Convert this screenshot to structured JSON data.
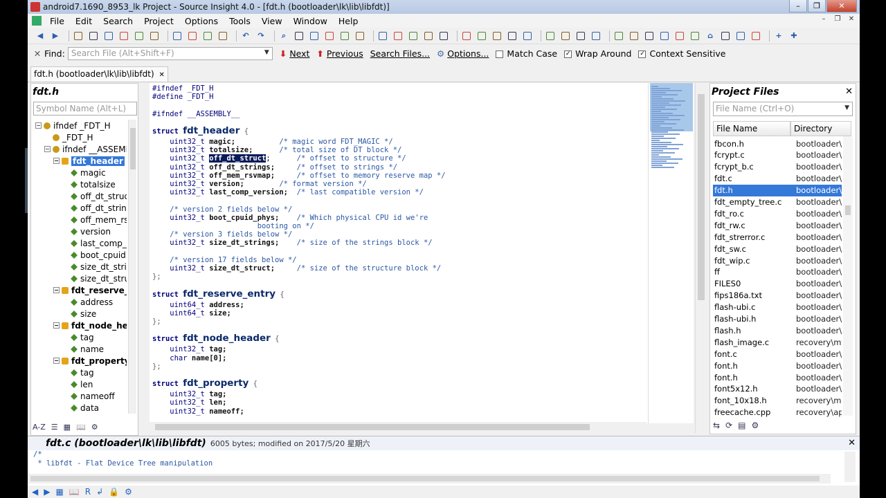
{
  "window": {
    "title": "android7.1690_8953_lk Project - Source Insight 4.0 - [fdt.h (bootloader\\lk\\lib\\libfdt)]",
    "buttons": {
      "min": "–",
      "max": "❐",
      "close": "✕"
    }
  },
  "menu": {
    "items": [
      "File",
      "Edit",
      "Search",
      "Project",
      "Options",
      "Tools",
      "View",
      "Window",
      "Help"
    ],
    "mdi": {
      "min": "–",
      "restore": "❐",
      "close": "✕"
    }
  },
  "toolbar": {
    "icons": [
      "back-arrow-icon",
      "forward-arrow-icon",
      "sep",
      "new-file-icon",
      "open-folder-icon",
      "save-icon",
      "save-all-icon",
      "close-file-icon",
      "print-icon",
      "sep",
      "cut-icon",
      "copy-icon",
      "paste-icon",
      "delete-icon",
      "sep",
      "undo-icon",
      "redo-icon",
      "sep",
      "search-icon",
      "search-files-icon",
      "next-icon",
      "prev-icon",
      "replace-icon",
      "window-icon",
      "sep",
      "bookmark-icon",
      "bookmark-next-icon",
      "bookmark-prev-icon",
      "goto-line-icon",
      "up-icon",
      "sep",
      "browse-icon",
      "symbol-icon",
      "book-icon",
      "jump-icon",
      "reference-icon",
      "sep",
      "layout-icon",
      "panel-left-icon",
      "panel-right-icon",
      "panel-bottom-icon",
      "sep",
      "context-icon",
      "relation-icon",
      "tree-icon",
      "file-icon",
      "settings-icon",
      "print2-icon",
      "home-icon",
      "bird-icon",
      "graph-icon",
      "grid-icon",
      "sep",
      "plus-icon",
      "add-icon"
    ],
    "glyphs": {
      "back-arrow-icon": "◀",
      "forward-arrow-icon": "▶",
      "undo-icon": "↶",
      "redo-icon": "↷",
      "plus-icon": "+",
      "add-icon": "✚",
      "home-icon": "⌂",
      "search-icon": "⌕"
    }
  },
  "findbar": {
    "close": "✕",
    "label": "Find:",
    "placeholder": "Search File (Alt+Shift+F)",
    "dropdown": "▼",
    "next": "Next",
    "previous": "Previous",
    "search_files": "Search Files...",
    "options": "Options...",
    "match_case": {
      "label": "Match Case",
      "checked": false
    },
    "wrap_around": {
      "label": "Wrap Around",
      "checked": true
    },
    "context_sensitive": {
      "label": "Context Sensitive",
      "checked": true
    }
  },
  "filetab": {
    "label": "fdt.h (bootloader\\lk\\lib\\libfdt)",
    "close": "✕"
  },
  "symbols": {
    "title": "fdt.h",
    "placeholder": "Symbol Name (Alt+L)",
    "items": [
      {
        "label": "ifndef _FDT_H",
        "kind": "def",
        "indent": 0,
        "exp": "−",
        "bold": false
      },
      {
        "label": "_FDT_H",
        "kind": "def",
        "indent": 1,
        "exp": "",
        "bold": false
      },
      {
        "label": "ifndef __ASSEMB",
        "kind": "def",
        "indent": 1,
        "exp": "−",
        "bold": false
      },
      {
        "label": "fdt_header",
        "kind": "st",
        "indent": 2,
        "exp": "−",
        "bold": true,
        "selected": true
      },
      {
        "label": "magic",
        "kind": "fld",
        "indent": 3,
        "exp": "",
        "bold": false
      },
      {
        "label": "totalsize",
        "kind": "fld",
        "indent": 3,
        "exp": "",
        "bold": false
      },
      {
        "label": "off_dt_struc",
        "kind": "fld",
        "indent": 3,
        "exp": "",
        "bold": false
      },
      {
        "label": "off_dt_string",
        "kind": "fld",
        "indent": 3,
        "exp": "",
        "bold": false
      },
      {
        "label": "off_mem_rs",
        "kind": "fld",
        "indent": 3,
        "exp": "",
        "bold": false
      },
      {
        "label": "version",
        "kind": "fld",
        "indent": 3,
        "exp": "",
        "bold": false
      },
      {
        "label": "last_comp_v",
        "kind": "fld",
        "indent": 3,
        "exp": "",
        "bold": false
      },
      {
        "label": "boot_cpuid",
        "kind": "fld",
        "indent": 3,
        "exp": "",
        "bold": false
      },
      {
        "label": "size_dt_strir",
        "kind": "fld",
        "indent": 3,
        "exp": "",
        "bold": false
      },
      {
        "label": "size_dt_stru",
        "kind": "fld",
        "indent": 3,
        "exp": "",
        "bold": false
      },
      {
        "label": "fdt_reserve_e",
        "kind": "st",
        "indent": 2,
        "exp": "−",
        "bold": true
      },
      {
        "label": "address",
        "kind": "fld",
        "indent": 3,
        "exp": "",
        "bold": false
      },
      {
        "label": "size",
        "kind": "fld",
        "indent": 3,
        "exp": "",
        "bold": false
      },
      {
        "label": "fdt_node_hea",
        "kind": "st",
        "indent": 2,
        "exp": "−",
        "bold": true
      },
      {
        "label": "tag",
        "kind": "fld",
        "indent": 3,
        "exp": "",
        "bold": false
      },
      {
        "label": "name",
        "kind": "fld",
        "indent": 3,
        "exp": "",
        "bold": false
      },
      {
        "label": "fdt_property",
        "kind": "st",
        "indent": 2,
        "exp": "−",
        "bold": true
      },
      {
        "label": "tag",
        "kind": "fld",
        "indent": 3,
        "exp": "",
        "bold": false
      },
      {
        "label": "len",
        "kind": "fld",
        "indent": 3,
        "exp": "",
        "bold": false
      },
      {
        "label": "nameoff",
        "kind": "fld",
        "indent": 3,
        "exp": "",
        "bold": false
      },
      {
        "label": "data",
        "kind": "fld",
        "indent": 3,
        "exp": "",
        "bold": false
      }
    ],
    "footer": [
      "A-Z",
      "☰",
      "▦",
      "📖",
      "⚙"
    ]
  },
  "code": [
    {
      "t": "pp",
      "s": "#ifndef _FDT_H"
    },
    {
      "t": "pp",
      "s": "#define _FDT_H"
    },
    {
      "t": "blank",
      "s": ""
    },
    {
      "t": "pp",
      "s": "#ifndef __ASSEMBLY__"
    },
    {
      "t": "blank",
      "s": ""
    },
    {
      "t": "struct",
      "s": "fdt_header"
    },
    {
      "t": "field",
      "type": "    uint32_t ",
      "name": "magic;",
      "cm": "          /* magic word FDT_MAGIC */"
    },
    {
      "t": "field",
      "type": "    uint32_t ",
      "name": "totalsize;",
      "cm": "      /* total size of DT block */"
    },
    {
      "t": "field",
      "type": "    uint32_t ",
      "name": "off_dt_struct",
      "tail": ";",
      "cm": "      /* offset to structure */",
      "hl": true
    },
    {
      "t": "field",
      "type": "    uint32_t ",
      "name": "off_dt_strings;",
      "cm": "     /* offset to strings */"
    },
    {
      "t": "field",
      "type": "    uint32_t ",
      "name": "off_mem_rsvmap;",
      "cm": "     /* offset to memory reserve map */"
    },
    {
      "t": "field",
      "type": "    uint32_t ",
      "name": "version;",
      "cm": "        /* format version */"
    },
    {
      "t": "field",
      "type": "    uint32_t ",
      "name": "last_comp_version;",
      "cm": "  /* last compatible version */"
    },
    {
      "t": "blank",
      "s": ""
    },
    {
      "t": "comment",
      "s": "    /* version 2 fields below */"
    },
    {
      "t": "field",
      "type": "    uint32_t ",
      "name": "boot_cpuid_phys;",
      "cm": "    /* Which physical CPU id we're"
    },
    {
      "t": "comment",
      "s": "                        booting on */"
    },
    {
      "t": "comment",
      "s": "    /* version 3 fields below */"
    },
    {
      "t": "field",
      "type": "    uint32_t ",
      "name": "size_dt_strings;",
      "cm": "    /* size of the strings block */"
    },
    {
      "t": "blank",
      "s": ""
    },
    {
      "t": "comment",
      "s": "    /* version 17 fields below */"
    },
    {
      "t": "field",
      "type": "    uint32_t ",
      "name": "size_dt_struct;",
      "cm": "     /* size of the structure block */"
    },
    {
      "t": "close",
      "s": "};"
    },
    {
      "t": "blank",
      "s": ""
    },
    {
      "t": "struct",
      "s": "fdt_reserve_entry"
    },
    {
      "t": "field",
      "type": "    uint64_t ",
      "name": "address;",
      "cm": ""
    },
    {
      "t": "field",
      "type": "    uint64_t ",
      "name": "size;",
      "cm": ""
    },
    {
      "t": "close",
      "s": "};"
    },
    {
      "t": "blank",
      "s": ""
    },
    {
      "t": "struct",
      "s": "fdt_node_header"
    },
    {
      "t": "field",
      "type": "    uint32_t ",
      "name": "tag;",
      "cm": ""
    },
    {
      "t": "field",
      "type": "    char ",
      "name": "name[0];",
      "cm": ""
    },
    {
      "t": "close",
      "s": "};"
    },
    {
      "t": "blank",
      "s": ""
    },
    {
      "t": "struct",
      "s": "fdt_property"
    },
    {
      "t": "field",
      "type": "    uint32_t ",
      "name": "tag;",
      "cm": ""
    },
    {
      "t": "field",
      "type": "    uint32_t ",
      "name": "len;",
      "cm": ""
    },
    {
      "t": "field",
      "type": "    uint32_t ",
      "name": "nameoff;",
      "cm": ""
    }
  ],
  "code_keyword": "struct",
  "project": {
    "title": "Project Files",
    "close": "✕",
    "placeholder": "File Name (Ctrl+O)",
    "dropdown": "▼",
    "col_name": "File Name",
    "col_dir": "Directory",
    "files": [
      {
        "name": "fbcon.h",
        "dir": "bootloader\\"
      },
      {
        "name": "fcrypt.c",
        "dir": "bootloader\\"
      },
      {
        "name": "fcrypt_b.c",
        "dir": "bootloader\\"
      },
      {
        "name": "fdt.c",
        "dir": "bootloader\\"
      },
      {
        "name": "fdt.h",
        "dir": "bootloader\\",
        "selected": true
      },
      {
        "name": "fdt_empty_tree.c",
        "dir": "bootloader\\"
      },
      {
        "name": "fdt_ro.c",
        "dir": "bootloader\\"
      },
      {
        "name": "fdt_rw.c",
        "dir": "bootloader\\"
      },
      {
        "name": "fdt_strerror.c",
        "dir": "bootloader\\"
      },
      {
        "name": "fdt_sw.c",
        "dir": "bootloader\\"
      },
      {
        "name": "fdt_wip.c",
        "dir": "bootloader\\"
      },
      {
        "name": "ff",
        "dir": "bootloader\\"
      },
      {
        "name": "FILES0",
        "dir": "bootloader\\"
      },
      {
        "name": "fips186a.txt",
        "dir": "bootloader\\"
      },
      {
        "name": "flash-ubi.c",
        "dir": "bootloader\\"
      },
      {
        "name": "flash-ubi.h",
        "dir": "bootloader\\"
      },
      {
        "name": "flash.h",
        "dir": "bootloader\\"
      },
      {
        "name": "flash_image.c",
        "dir": "recovery\\mt"
      },
      {
        "name": "font.c",
        "dir": "bootloader\\"
      },
      {
        "name": "font.h",
        "dir": "bootloader\\"
      },
      {
        "name": "font.h",
        "dir": "bootloader\\"
      },
      {
        "name": "font5x12.h",
        "dir": "bootloader\\"
      },
      {
        "name": "font_10x18.h",
        "dir": "recovery\\mi"
      },
      {
        "name": "freecache.cpp",
        "dir": "recovery\\ap"
      }
    ],
    "footer": [
      "⇆",
      "⟳",
      "▤",
      "⚙"
    ]
  },
  "context": {
    "file": "fdt.c (bootloader\\lk\\lib\\libfdt)",
    "info": "6005 bytes; modified on 2017/5/20 星期六",
    "close": "✕",
    "lines": [
      "/*",
      " * libfdt - Flat Device Tree manipulation"
    ]
  },
  "statusbar": [
    "◀",
    "▶",
    "▦",
    "📖",
    "R",
    "↲",
    "🔒",
    "⚙"
  ],
  "colors": {
    "accent": "#3478d8",
    "keyword": "#00007b",
    "comment": "#2b57a3",
    "selection": "#0a1a5a"
  }
}
